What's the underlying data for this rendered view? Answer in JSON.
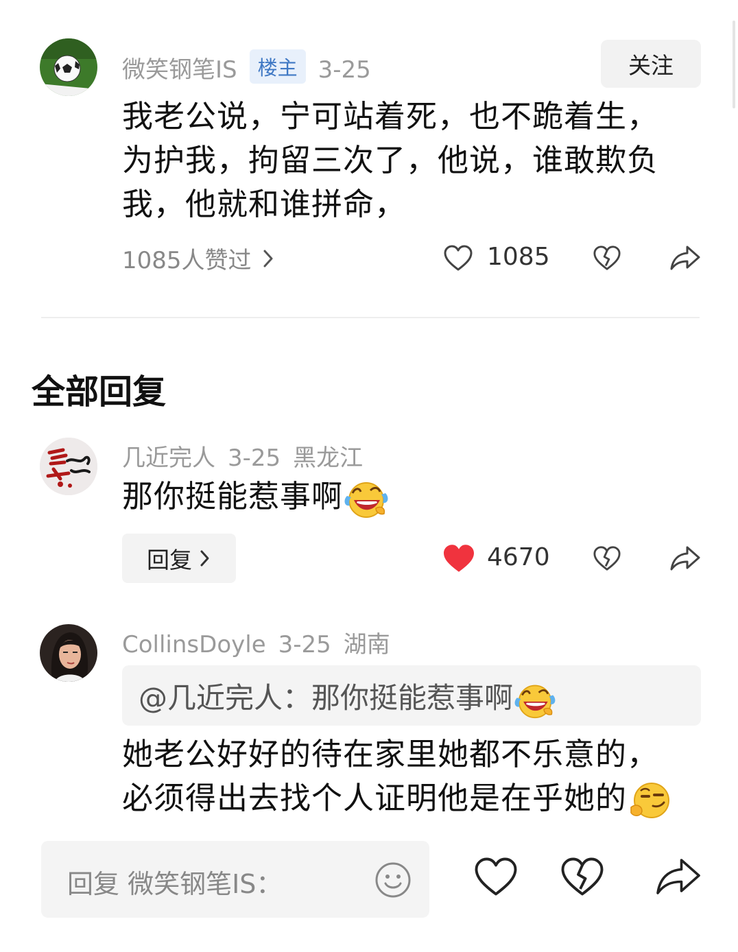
{
  "post": {
    "username": "微笑钢笔IS",
    "badge": "楼主",
    "date": "3-25",
    "follow_label": "关注",
    "lines": [
      "我老公说，宁可站着死，也不跪着生，",
      "为护我，拘留三次了，他说，谁敢欺负",
      "我，他就和谁拼命，"
    ],
    "likes_summary": "1085人赞过",
    "like_count": "1085"
  },
  "section_title": "全部回复",
  "replies": [
    {
      "username": "几近完人",
      "date": "3-25",
      "location": "黑龙江",
      "text": "那你挺能惹事啊",
      "emoji": "laughing-crying-emoji",
      "reply_label": "回复",
      "like_count": "4670",
      "liked": true
    },
    {
      "username": "CollinsDoyle",
      "date": "3-25",
      "location": "湖南",
      "quote": "@几近完人：那你挺能惹事啊",
      "lines": [
        "她老公好好的待在家里她都不乐意的，",
        "必须得出去找个人证明他是在乎她的"
      ],
      "emoji": "smirk-emoji"
    }
  ],
  "input": {
    "placeholder": "回复 微笑钢笔IS："
  },
  "colors": {
    "like_red": "#f0333e",
    "badge_bg": "#e8f0fb",
    "badge_text": "#3f78c4",
    "muted": "#9a9a9a"
  }
}
